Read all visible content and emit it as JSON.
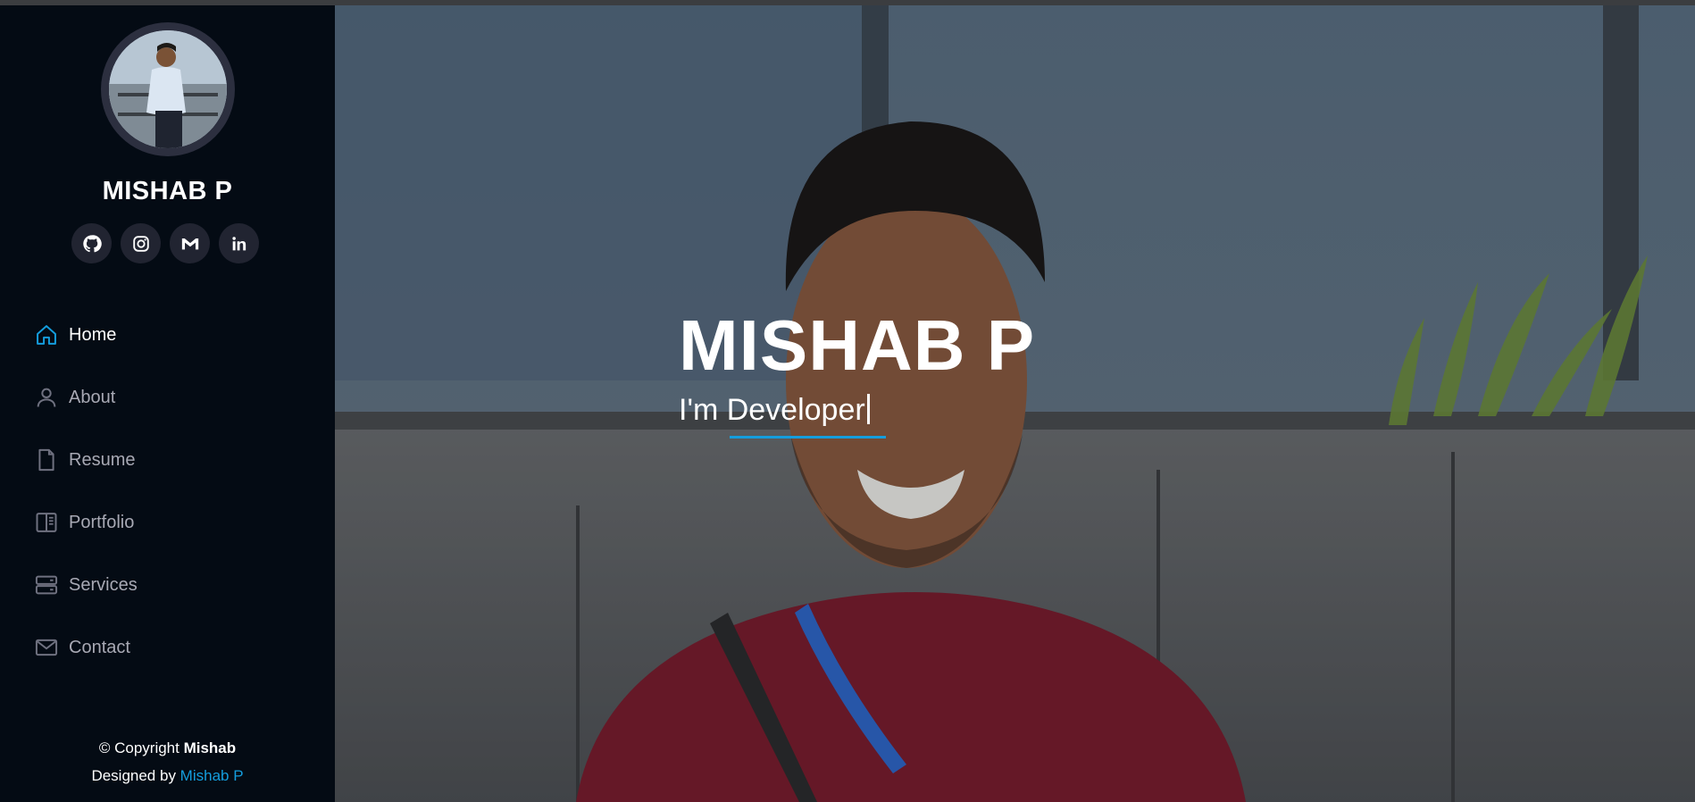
{
  "profile": {
    "name": "MISHAB P",
    "photo_alt": "profile photo"
  },
  "socials": [
    {
      "name": "github",
      "icon": "github-icon"
    },
    {
      "name": "instagram",
      "icon": "instagram-icon"
    },
    {
      "name": "gmail",
      "icon": "gmail-icon"
    },
    {
      "name": "linkedin",
      "icon": "linkedin-icon"
    }
  ],
  "nav": {
    "items": [
      {
        "label": "Home",
        "icon": "home-icon",
        "active": true
      },
      {
        "label": "About",
        "icon": "person-icon",
        "active": false
      },
      {
        "label": "Resume",
        "icon": "file-icon",
        "active": false
      },
      {
        "label": "Portfolio",
        "icon": "book-icon",
        "active": false
      },
      {
        "label": "Services",
        "icon": "server-icon",
        "active": false
      },
      {
        "label": "Contact",
        "icon": "envelope-icon",
        "active": false
      }
    ]
  },
  "footer": {
    "copyright_prefix": "© Copyright ",
    "copyright_name": "Mishab",
    "designed_prefix": "Designed by ",
    "designer": "Mishab P"
  },
  "hero": {
    "title": "MISHAB P",
    "subtitle": "I'm Developer"
  },
  "colors": {
    "sidebar_bg": "#040b14",
    "accent": "#149ddd",
    "social_bg": "#212431",
    "nav_text": "#a8a9b4"
  }
}
